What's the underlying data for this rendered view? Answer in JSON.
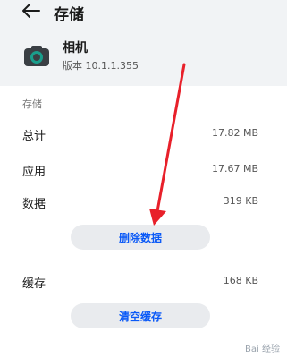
{
  "header": {
    "title": "存储",
    "back_icon": "back-arrow-icon"
  },
  "app": {
    "name": "相机",
    "version": "版本 10.1.1.355",
    "icon": "camera-icon",
    "icon_color": "#1a9e8c"
  },
  "storage": {
    "section_label": "存储",
    "rows": [
      {
        "label": "总计",
        "value": "17.82 MB"
      },
      {
        "label": "应用",
        "value": "17.67 MB"
      },
      {
        "label": "数据",
        "value": "319 KB"
      }
    ],
    "clear_data_button": "删除数据",
    "cache": {
      "label": "缓存",
      "value": "168 KB"
    },
    "clear_cache_button": "清空缓存"
  },
  "annotation": {
    "arrow_color": "#e8202a"
  },
  "accent_color": "#0a59f7",
  "watermark": "Bai 经验"
}
